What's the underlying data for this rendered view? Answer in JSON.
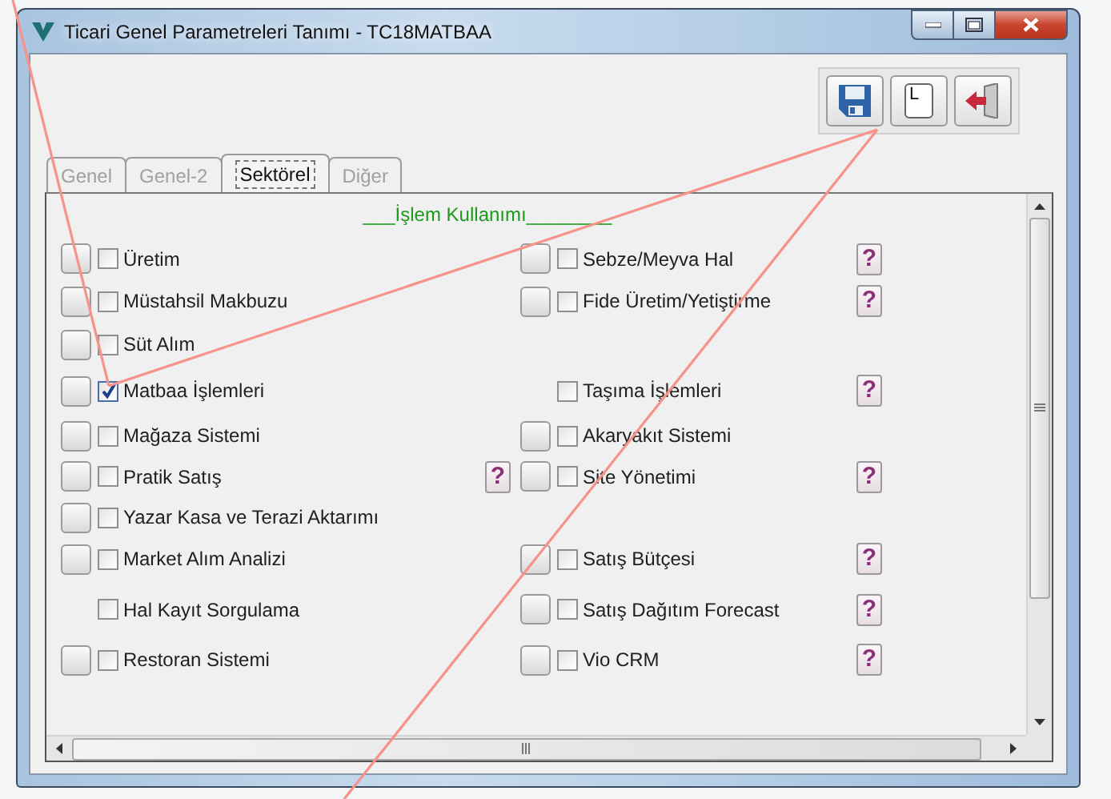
{
  "window": {
    "title": "Ticari Genel Parametreleri Tanımı - TC18MATBAA"
  },
  "toolbar": [
    {
      "kind": "save"
    },
    {
      "kind": "letter",
      "label": "L"
    },
    {
      "kind": "exit"
    }
  ],
  "tabs": [
    {
      "label": "Genel",
      "selected": false
    },
    {
      "label": "Genel-2",
      "selected": false
    },
    {
      "label": "Sektörel",
      "selected": true
    },
    {
      "label": "Diğer",
      "selected": false
    }
  ],
  "section_title": "___İşlem Kullanımı________",
  "rows": [
    {
      "left": {
        "label": "Üretim",
        "checked": false,
        "button": true
      },
      "right": {
        "label": "Sebze/Meyva Hal",
        "checked": false,
        "button": true,
        "help": "?"
      }
    },
    {
      "left": {
        "label": "Müstahsil Makbuzu",
        "checked": false,
        "button": true
      },
      "right": {
        "label": "Fide Üretim/Yetiştirme",
        "checked": false,
        "button": true,
        "help": "?"
      }
    },
    {
      "left": {
        "label": "Süt Alım",
        "checked": false,
        "button": true
      }
    },
    {
      "left": {
        "label": "Matbaa İşlemleri",
        "checked": true,
        "button": true
      },
      "right": {
        "label": "Taşıma İşlemleri",
        "checked": false,
        "button": false,
        "help": "?"
      }
    },
    {
      "left": {
        "label": "Mağaza Sistemi",
        "checked": false,
        "button": true
      },
      "right": {
        "label": "Akaryakıt Sistemi",
        "checked": false,
        "button": true
      }
    },
    {
      "left": {
        "label": "Pratik Satış",
        "checked": false,
        "button": true,
        "help": "?"
      },
      "right": {
        "label": "Site Yönetimi",
        "checked": false,
        "button": true,
        "help": "?"
      }
    },
    {
      "left": {
        "label": "Yazar Kasa ve Terazi Aktarımı",
        "checked": false,
        "button": true
      }
    },
    {
      "left": {
        "label": "Market Alım Analizi",
        "checked": false,
        "button": true
      },
      "right": {
        "label": "Satış Bütçesi",
        "checked": false,
        "button": true,
        "help": "?"
      }
    },
    {
      "left": {
        "label": "Hal Kayıt Sorgulama",
        "checked": false,
        "button": false
      },
      "right": {
        "label": "Satış Dağıtım Forecast",
        "checked": false,
        "button": true,
        "help": "?"
      }
    },
    {
      "left": {
        "label": "Restoran Sistemi",
        "checked": false,
        "button": true
      },
      "right": {
        "label": "Vio CRM",
        "checked": false,
        "button": true,
        "help": "?"
      }
    }
  ]
}
